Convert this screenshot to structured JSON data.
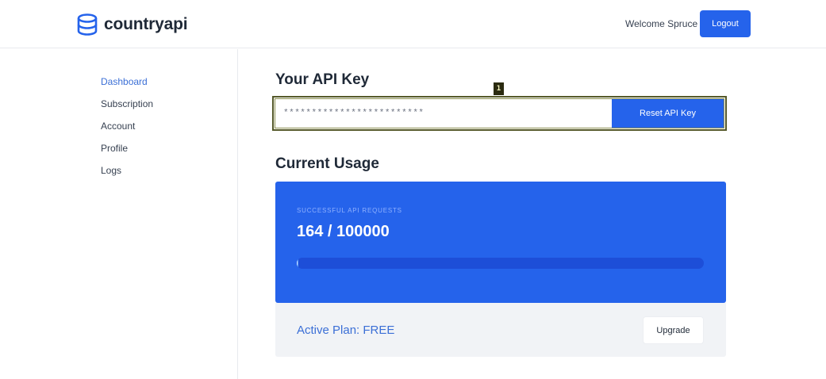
{
  "header": {
    "brand": "countryapi",
    "welcome": "Welcome Spruce",
    "logout_label": "Logout",
    "brand_color": "#2563eb"
  },
  "sidebar": {
    "items": [
      {
        "label": "Dashboard",
        "active": true
      },
      {
        "label": "Subscription",
        "active": false
      },
      {
        "label": "Account",
        "active": false
      },
      {
        "label": "Profile",
        "active": false
      },
      {
        "label": "Logs",
        "active": false
      }
    ]
  },
  "api_key": {
    "title": "Your API Key",
    "masked_value": "*************************",
    "reset_label": "Reset API Key",
    "marker_label": "1"
  },
  "usage": {
    "title": "Current Usage",
    "label": "SUCCESSFUL API REQUESTS",
    "value_text": "164 / 100000",
    "used": 164,
    "limit": 100000,
    "card_color": "#2563eb"
  },
  "plan": {
    "label": "Active Plan: FREE",
    "upgrade_label": "Upgrade"
  }
}
